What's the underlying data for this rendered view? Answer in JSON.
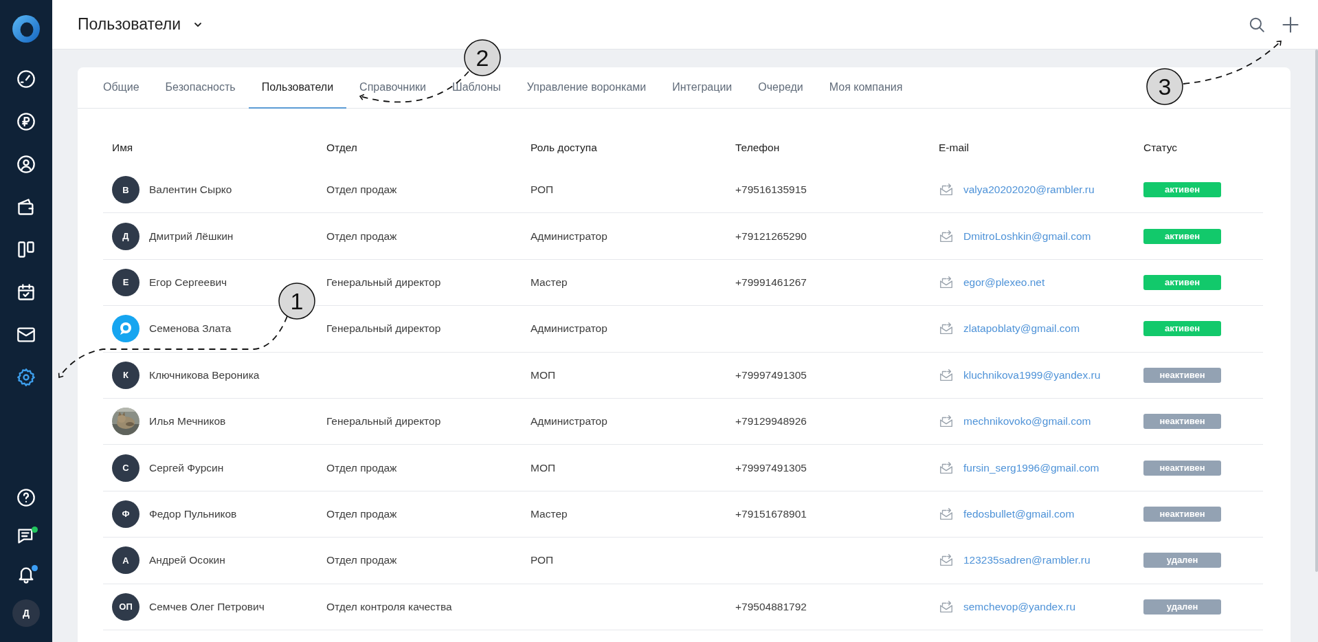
{
  "sidebar": {
    "items": [
      {
        "kind": "gauge",
        "selected": false
      },
      {
        "kind": "ruble",
        "selected": false
      },
      {
        "kind": "user",
        "selected": false
      },
      {
        "kind": "wallet",
        "selected": false
      },
      {
        "kind": "columns",
        "selected": false
      },
      {
        "kind": "calendar",
        "selected": false
      },
      {
        "kind": "mail",
        "selected": false
      },
      {
        "kind": "gear",
        "selected": true
      }
    ],
    "bottom": [
      {
        "kind": "help"
      },
      {
        "kind": "chat",
        "color": "#22c55e"
      },
      {
        "kind": "bell",
        "color": "#3b9ef5"
      }
    ],
    "user_initial": "Д"
  },
  "header": {
    "title": "Пользователи"
  },
  "tabs": [
    {
      "label": "Общие",
      "selected": false
    },
    {
      "label": "Безопасность",
      "selected": false
    },
    {
      "label": "Пользователи",
      "selected": true
    },
    {
      "label": "Справочники",
      "selected": false
    },
    {
      "label": "Шаблоны",
      "selected": false
    },
    {
      "label": "Управление воронками",
      "selected": false
    },
    {
      "label": "Интеграции",
      "selected": false
    },
    {
      "label": "Очереди",
      "selected": false
    },
    {
      "label": "Моя компания",
      "selected": false
    }
  ],
  "table": {
    "columns": [
      "Имя",
      "Отдел",
      "Роль доступа",
      "Телефон",
      "E-mail",
      "Статус"
    ],
    "rows": [
      {
        "avatar": {
          "kind": "initials",
          "text": "В"
        },
        "name": "Валентин Сырко",
        "department": "Отдел продаж",
        "role": "РОП",
        "phone": "+79516135915",
        "email": "valya20202020@rambler.ru",
        "status": {
          "text": "активен",
          "kind": "active"
        }
      },
      {
        "avatar": {
          "kind": "initials",
          "text": "Д"
        },
        "name": "Дмитрий Лёшкин",
        "department": "Отдел продаж",
        "role": "Администратор",
        "phone": "+79121265290",
        "email": "DmitroLoshkin@gmail.com",
        "status": {
          "text": "активен",
          "kind": "active"
        }
      },
      {
        "avatar": {
          "kind": "initials",
          "text": "Е"
        },
        "name": "Егор Сергеевич",
        "department": "Генеральный директор",
        "role": "Мастер",
        "phone": "+79991461267",
        "email": "egor@plexeo.net",
        "status": {
          "text": "активен",
          "kind": "active"
        }
      },
      {
        "avatar": {
          "kind": "logo"
        },
        "name": "Семенова Злата",
        "department": "Генеральный директор",
        "role": "Администратор",
        "email": "zlatapoblaty@gmail.com",
        "status": {
          "text": "активен",
          "kind": "active"
        }
      },
      {
        "avatar": {
          "kind": "initials",
          "text": "К"
        },
        "name": "Ключникова Вероника",
        "role": "МОП",
        "phone": "+79997491305",
        "email": "kluchnikova1999@yandex.ru",
        "status": {
          "text": "неактивен",
          "kind": "inactive"
        }
      },
      {
        "name": "Илья Мечников",
        "department": "Генеральный директор",
        "role": "Администратор",
        "phone": "+79129948926",
        "email": "mechnikovoko@gmail.com",
        "status": {
          "text": "неактивен",
          "kind": "inactive"
        }
      },
      {
        "avatar": {
          "kind": "initials",
          "text": "С"
        },
        "name": "Сергей Фурсин",
        "department": "Отдел продаж",
        "role": "МОП",
        "phone": "+79997491305",
        "email": "fursin_serg1996@gmail.com",
        "status": {
          "text": "неактивен",
          "kind": "inactive"
        }
      },
      {
        "avatar": {
          "kind": "initials",
          "text": "Ф"
        },
        "name": "Федор Пульников",
        "department": "Отдел продаж",
        "role": "Мастер",
        "phone": "+79151678901",
        "email": "fedosbullet@gmail.com",
        "status": {
          "text": "неактивен",
          "kind": "inactive"
        }
      },
      {
        "avatar": {
          "kind": "initials",
          "text": "А"
        },
        "name": "Андрей Осокин",
        "department": "Отдел продаж",
        "role": "РОП",
        "email": "123235sadren@rambler.ru",
        "status": {
          "text": "удален",
          "kind": "deleted"
        }
      },
      {
        "avatar": {
          "kind": "initials",
          "text": "ОП"
        },
        "name": "Семчев Олег Петрович",
        "department": "Отдел контроля качества",
        "phone": "+79504881792",
        "email": "semchevop@yandex.ru",
        "status": {
          "text": "удален",
          "kind": "deleted"
        }
      }
    ]
  },
  "annotations": [
    {
      "label": "1"
    },
    {
      "label": "2"
    },
    {
      "label": "3"
    }
  ]
}
